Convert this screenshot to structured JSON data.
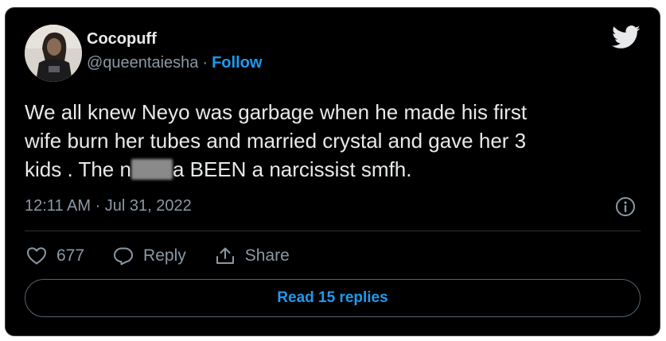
{
  "author": {
    "name": "Cocopuff",
    "handle": "@queentaiesha",
    "separator": "·",
    "follow_label": "Follow"
  },
  "tweet": {
    "text_line1": "We all knew Neyo was garbage when he made his first",
    "text_line2": "wife burn her tubes and married crystal and gave her 3",
    "text_line3_start": "kids . The n",
    "text_line3_end": "a BEEN a narcissist smfh.",
    "timestamp": "12:11 AM · Jul 31, 2022"
  },
  "actions": {
    "like_count": "677",
    "reply_label": "Reply",
    "share_label": "Share"
  },
  "read_replies_label": "Read 15 replies",
  "icons": [
    "twitter-bird-icon",
    "info-icon",
    "heart-icon",
    "reply-icon",
    "share-icon"
  ],
  "colors": {
    "background": "#000000",
    "text": "#e7e9ea",
    "muted": "#8b98a5",
    "accent": "#1d9bf0"
  }
}
